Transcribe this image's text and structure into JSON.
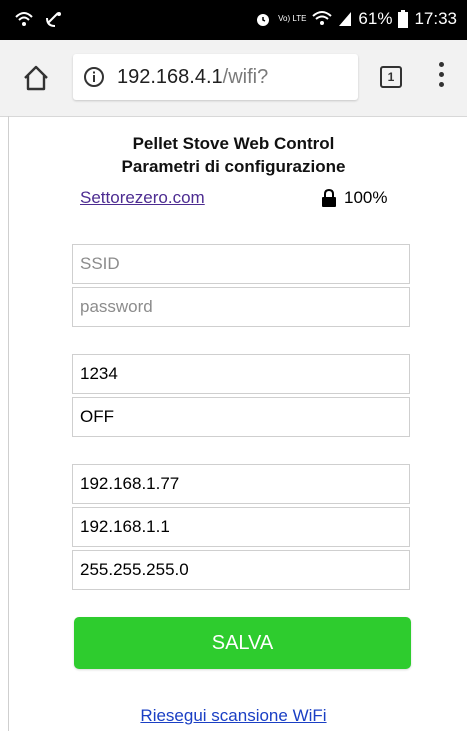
{
  "status_bar": {
    "battery": "61%",
    "time": "17:33",
    "lte": "Vo) LTE"
  },
  "browser": {
    "url_host": "192.168.4.1",
    "url_path": "/wifi?",
    "tab_count": "1"
  },
  "page": {
    "title": "Pellet Stove Web Control",
    "subtitle": "Parametri di configurazione",
    "site_link": "Settorezero.com",
    "signal": "100%"
  },
  "form": {
    "ssid_placeholder": "SSID",
    "password_placeholder": "password",
    "pin_value": "1234",
    "mode_value": "OFF",
    "ip_value": "192.168.1.77",
    "gateway_value": "192.168.1.1",
    "subnet_value": "255.255.255.0",
    "save_label": "SALVA"
  },
  "footer": {
    "rescan_label": "Riesegui scansione WiFi"
  },
  "colors": {
    "save_button": "#2ecc2e",
    "link": "#1a3fc4",
    "visited_link": "#4d2c91"
  }
}
